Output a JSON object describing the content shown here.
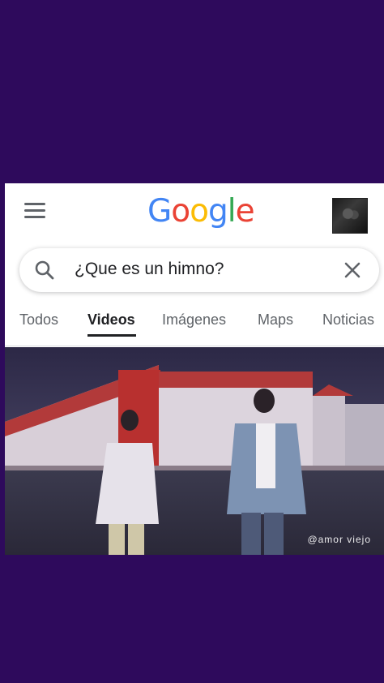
{
  "header": {
    "menu_icon": "menu-icon",
    "logo": "Google",
    "avatar": "avatar"
  },
  "search": {
    "query": "¿Que es un himno?",
    "search_icon": "search-icon",
    "clear_icon": "close-icon"
  },
  "tabs": [
    {
      "label": "Todos",
      "active": false
    },
    {
      "label": "Videos",
      "active": true
    },
    {
      "label": "Imágenes",
      "active": false
    },
    {
      "label": "Maps",
      "active": false
    },
    {
      "label": "Noticias",
      "active": false
    }
  ],
  "video": {
    "watermark": "@amor viejo"
  },
  "colors": {
    "background": "#2e0a5c",
    "google_blue": "#4285F4",
    "google_red": "#EA4335",
    "google_yellow": "#FBBC05",
    "google_green": "#34A853"
  }
}
